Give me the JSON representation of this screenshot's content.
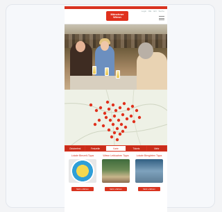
{
  "site": {
    "logo_text": "Münchner Wiesn",
    "toplinks": [
      "Login",
      "DE",
      "EN",
      "Suche"
    ],
    "menu_icon": "hamburger-menu-icon"
  },
  "hero": {
    "alt": ""
  },
  "map": {
    "marker_color": "#e0311d",
    "marker_icon": "map-pin-icon"
  },
  "tabs": [
    {
      "label": "Oktoberfest"
    },
    {
      "label": "Festzelte"
    },
    {
      "label": "Karte"
    },
    {
      "label": "Tickets"
    },
    {
      "label": "Mehr"
    }
  ],
  "cards": [
    {
      "title": "Lokale Bierzelt-Tipps",
      "button": "Mehr erfahren"
    },
    {
      "title": "Wiesn Lebkuchen Tipps",
      "button": "Mehr erfahren"
    },
    {
      "title": "Lokale Biergärten Tipps",
      "button": "Mehr erfahren"
    }
  ],
  "colors": {
    "brand": "#d9331f",
    "background": "#f3f4f6"
  }
}
